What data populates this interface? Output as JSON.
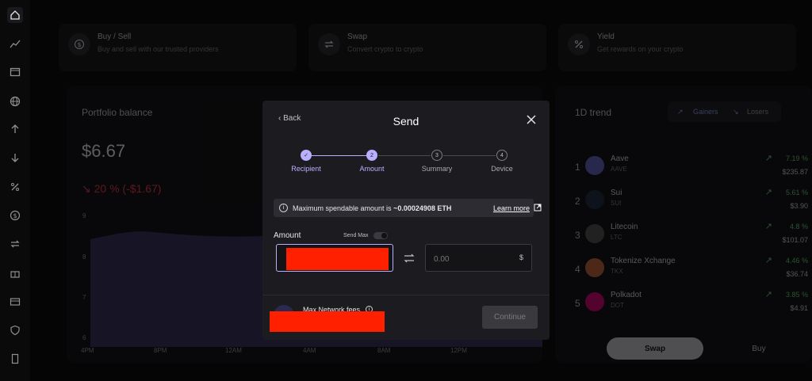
{
  "top_cards": [
    {
      "title": "Buy / Sell",
      "subtitle": "Buy and sell with our trusted providers",
      "icon": "dollar-icon"
    },
    {
      "title": "Swap",
      "subtitle": "Convert crypto to crypto",
      "icon": "swap-icon"
    },
    {
      "title": "Yield",
      "subtitle": "Get rewards on your crypto",
      "icon": "percent-icon"
    }
  ],
  "portfolio": {
    "title": "Portfolio balance",
    "value": "$6.67",
    "change": "20 % (-$1.67)",
    "y_ticks": [
      "9",
      "8",
      "7",
      "6"
    ],
    "x_ticks": [
      "4PM",
      "8PM",
      "12AM",
      "4AM",
      "8AM",
      "12PM"
    ]
  },
  "trend": {
    "title": "1D trend",
    "tab_gainers": "Gainers",
    "tab_losers": "Losers",
    "coins": [
      {
        "rank": "1",
        "name": "Aave",
        "ticker": "AAVE",
        "change": "7.19 %",
        "price": "$235.87"
      },
      {
        "rank": "2",
        "name": "Sui",
        "ticker": "SUI",
        "change": "5.61 %",
        "price": "$3.90"
      },
      {
        "rank": "3",
        "name": "Litecoin",
        "ticker": "LTC",
        "change": "4.8 %",
        "price": "$101.07"
      },
      {
        "rank": "4",
        "name": "Tokenize Xchange",
        "ticker": "TKX",
        "change": "4.46 %",
        "price": "$36.74"
      },
      {
        "rank": "5",
        "name": "Polkadot",
        "ticker": "DOT",
        "change": "3.85 %",
        "price": "$4.91"
      }
    ],
    "swap_label": "Swap",
    "buy_label": "Buy"
  },
  "modal": {
    "back_label": "Back",
    "title": "Send",
    "steps": [
      {
        "num": "✓",
        "label": "Recipient"
      },
      {
        "num": "2",
        "label": "Amount"
      },
      {
        "num": "3",
        "label": "Summary"
      },
      {
        "num": "4",
        "label": "Device"
      }
    ],
    "info_prefix": "Maximum spendable amount is ",
    "info_amount": "~0.00024908 ETH",
    "learn_more": "Learn more",
    "amount_label": "Amount",
    "send_max_label": "Send Max",
    "fiat_placeholder": "0.00",
    "fiat_currency": "$",
    "fees_label": "Max Network fees",
    "continue_label": "Continue"
  },
  "colors": {
    "accent": "#b8b0ff",
    "negative": "#ff3b46",
    "positive": "#6fe07a"
  }
}
